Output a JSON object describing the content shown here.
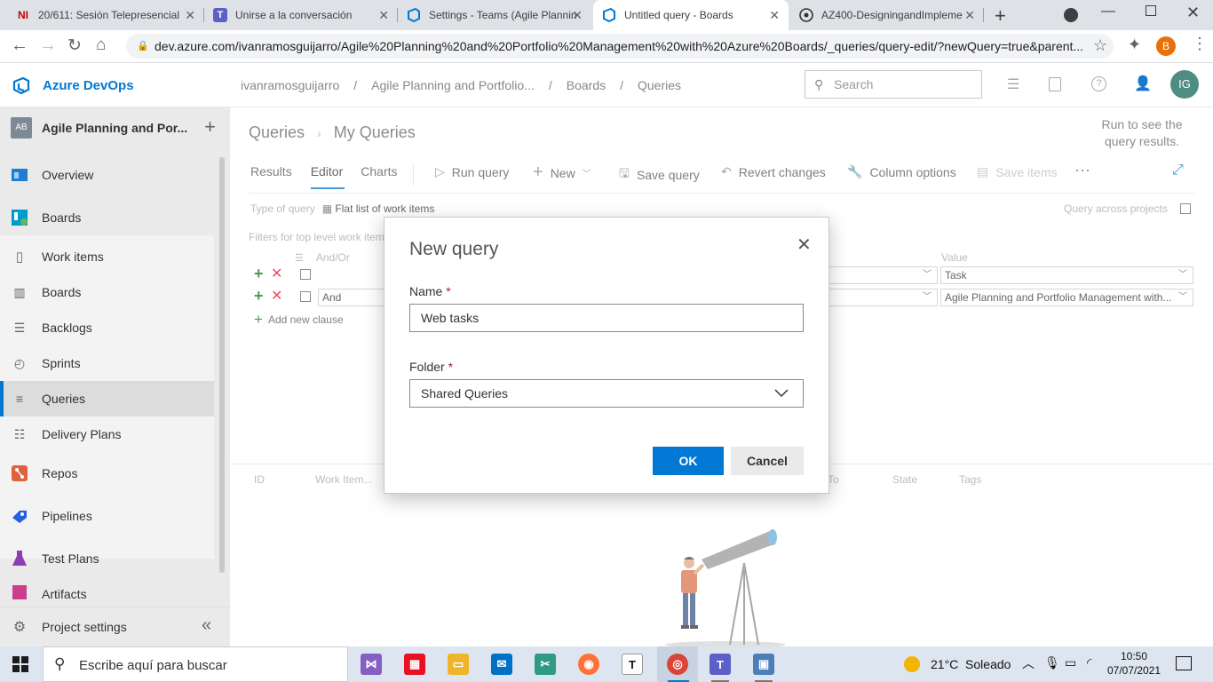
{
  "browser": {
    "tabs": [
      {
        "title": "20/611: Sesión Telepresencial",
        "favicon": "NI"
      },
      {
        "title": "Unirse a la conversación",
        "favicon": "teams-icon"
      },
      {
        "title": "Settings - Teams (Agile Plannin",
        "favicon": "azure-devops-icon"
      },
      {
        "title": "Untitled query - Boards",
        "favicon": "azure-devops-icon"
      },
      {
        "title": "AZ400-DesigningandImpleme",
        "favicon": "github-icon"
      }
    ],
    "url": "dev.azure.com/ivanramosguijarro/Agile%20Planning%20and%20Portfolio%20Management%20with%20Azure%20Boards/_queries/query-edit/?newQuery=true&parent...",
    "profile_initial": "B"
  },
  "header": {
    "brand": "Azure DevOps",
    "breadcrumbs": [
      "ivanramosguijarro",
      "Agile Planning and Portfolio...",
      "Boards",
      "Queries"
    ],
    "search_placeholder": "Search",
    "avatar_initials": "IG"
  },
  "sidebar": {
    "project_badge": "AB",
    "project_name": "Agile Planning and Por...",
    "items": [
      {
        "label": "Overview"
      },
      {
        "label": "Boards"
      },
      {
        "label": "Work items"
      },
      {
        "label": "Boards"
      },
      {
        "label": "Backlogs"
      },
      {
        "label": "Sprints"
      },
      {
        "label": "Queries"
      },
      {
        "label": "Delivery Plans"
      },
      {
        "label": "Repos"
      },
      {
        "label": "Pipelines"
      },
      {
        "label": "Test Plans"
      },
      {
        "label": "Artifacts"
      }
    ],
    "settings_label": "Project settings"
  },
  "main": {
    "breadcrumb_root": "Queries",
    "breadcrumb_current": "My Queries",
    "run_hint": "Run to see the query results.",
    "tabs": [
      "Results",
      "Editor",
      "Charts"
    ],
    "active_tab": "Editor",
    "commands": {
      "run": "Run query",
      "new": "New",
      "save": "Save query",
      "revert": "Revert changes",
      "columns": "Column options",
      "save_items": "Save items"
    },
    "type_of_query_label": "Type of query",
    "type_of_query_value": "Flat list of work items",
    "query_across_label": "Query across projects",
    "filters_label": "Filters for top level work item",
    "andor_header": "And/Or",
    "value_header": "Value",
    "clauses": [
      {
        "andor": "",
        "value": "Task"
      },
      {
        "andor": "And",
        "value": "Agile Planning and Portfolio Management with..."
      }
    ],
    "add_clause": "Add new clause",
    "result_columns": [
      "ID",
      "Work Item...",
      "To",
      "State",
      "Tags"
    ]
  },
  "dialog": {
    "title": "New query",
    "name_label": "Name",
    "name_value": "Web tasks",
    "folder_label": "Folder",
    "folder_value": "Shared Queries",
    "required_mark": "*",
    "ok": "OK",
    "cancel": "Cancel"
  },
  "taskbar": {
    "search_placeholder": "Escribe aquí para buscar",
    "weather": "21°C  Soleado",
    "time": "10:50",
    "date": "07/07/2021"
  },
  "colors": {
    "accent": "#0078d4",
    "sidebar_bg": "#eaeaea",
    "tabbar_bg": "#dee1e6",
    "delete_red": "#e81123",
    "add_green": "#107c10"
  }
}
